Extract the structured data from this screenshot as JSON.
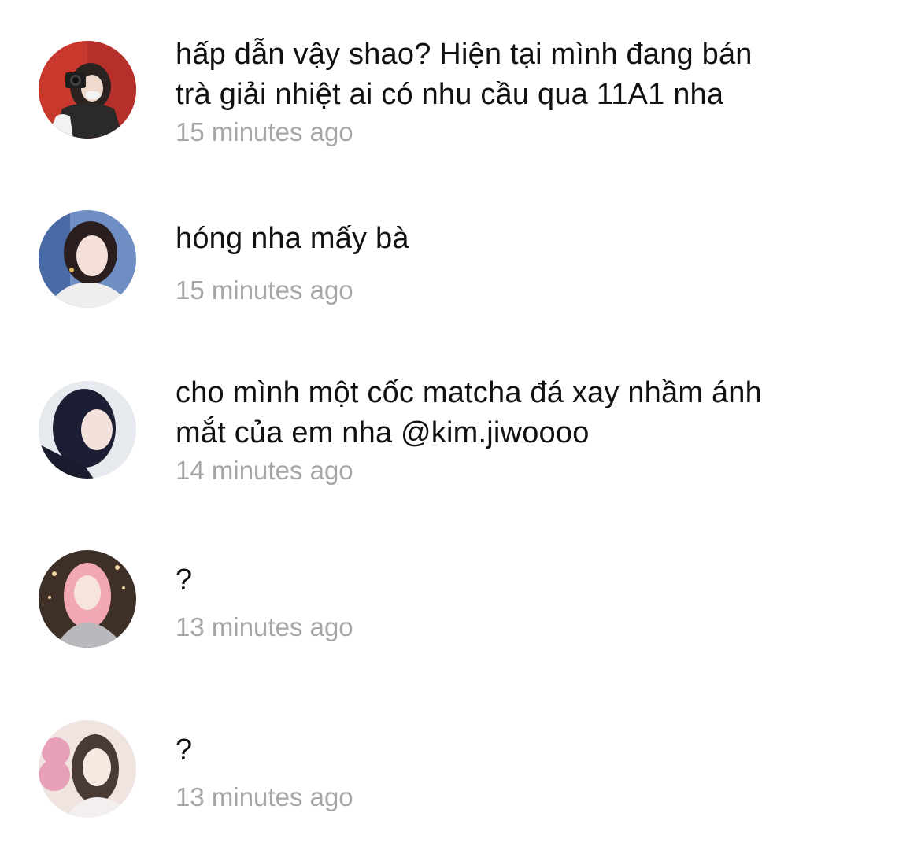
{
  "comments": [
    {
      "text": "hấp dẫn vậy shao? Hiện tại mình đang bán\ntrà giải nhiệt ai có nhu cầu qua 11A1 nha",
      "time": "15 minutes ago",
      "avatar_bg": "#c8382c"
    },
    {
      "text": "hóng nha mấy bà",
      "time": "15 minutes ago",
      "avatar_bg": "#5c7db8"
    },
    {
      "text": "cho mình một cốc matcha đá xay nhầm ánh\nmắt của em nha @kim.jiwoooo",
      "time": "14 minutes ago",
      "avatar_bg": "#dfe2e8"
    },
    {
      "text": "?",
      "time": "13 minutes ago",
      "avatar_bg": "#4a3a2e"
    },
    {
      "text": "?",
      "time": "13 minutes ago",
      "avatar_bg": "#f0e6e2"
    }
  ]
}
